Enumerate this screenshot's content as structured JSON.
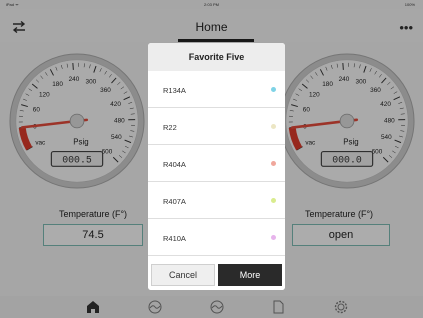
{
  "status_bar": {
    "carrier": "iPad ᯤ",
    "time": "2:03 PM",
    "battery": "100%"
  },
  "nav": {
    "title": "Home",
    "menu_icon": "swap-arrows-icon",
    "more_icon": "ellipsis-icon",
    "more_glyph": "•••"
  },
  "gauge_left": {
    "tick_labels": [
      "vac",
      "0",
      "60",
      "120",
      "180",
      "240",
      "300",
      "360",
      "420",
      "480",
      "540",
      "600"
    ],
    "unit": "Psig",
    "readout": "000.5",
    "needle_value": 0.5
  },
  "gauge_right": {
    "tick_labels": [
      "vac",
      "0",
      "60",
      "120",
      "180",
      "240",
      "300",
      "360",
      "420",
      "480",
      "540",
      "600"
    ],
    "unit": "Psig",
    "readout": "000.0",
    "needle_value": 0.0
  },
  "left_panel": {
    "temp_label": "Temperature (F°)",
    "temp_value": "74.5"
  },
  "right_panel": {
    "temp_label": "Temperature (F°)",
    "temp_value": "open"
  },
  "popup": {
    "title": "Favorite Five",
    "items": [
      {
        "label": "R134A",
        "dot_color": "#7fd3e6"
      },
      {
        "label": "R22",
        "dot_color": "#ece6c4"
      },
      {
        "label": "R404A",
        "dot_color": "#f0a79c"
      },
      {
        "label": "R407A",
        "dot_color": "#d9ec8e"
      },
      {
        "label": "R410A",
        "dot_color": "#e7b4ec"
      }
    ],
    "cancel_label": "Cancel",
    "more_label": "More"
  },
  "tabs": [
    {
      "name": "home-icon"
    },
    {
      "name": "gauge-icon"
    },
    {
      "name": "gauge-alt-icon"
    },
    {
      "name": "document-icon"
    },
    {
      "name": "gear-icon"
    }
  ],
  "colors": {
    "accent_teal": "#7ab8b0",
    "needle_red": "#e04a3a",
    "vac_red": "#d93a2a"
  }
}
